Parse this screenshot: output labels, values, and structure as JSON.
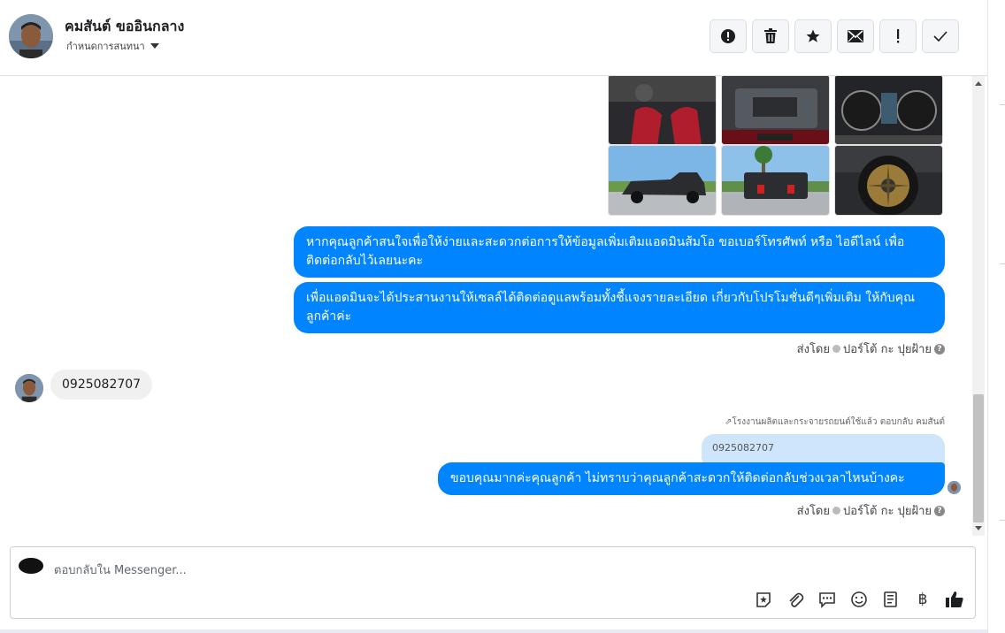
{
  "header": {
    "name": "คมสันต์ ขออินกลาง",
    "subtitle": "กำหนดการสนทนา"
  },
  "icons": {
    "actions": [
      "alert-circle-icon",
      "trash-icon",
      "star-icon",
      "envelope-icon",
      "exclamation-icon",
      "check-icon"
    ]
  },
  "messages": {
    "outgoing_1": "หากคุณลูกค้าสนใจเพื่อให้ง่ายและสะดวกต่อการให้ข้อมูลเพิ่มเติมแอดมินส้มโอ ขอเบอร์โทรศัพท์ หรือ ไอดีไลน์ เพื่อติดต่อกลับไว้เลยนะคะ",
    "outgoing_2": "เพื่อแอดมินจะได้ประสานงานให้เซลล์ได้ติดต่อดูแลพร้อมทั้งชี้แจงรายละเอียด เกี่ยวกับโปรโมชั่นดีๆเพิ่มเติม ให้กับคุณลูกค้าค่ะ",
    "sent_by_1": "ส่งโดย",
    "sent_by_name_1": "ปอร์โต้ กะ ปุยฝ้าย",
    "incoming": "0925082707",
    "reply_note": "โรงงานผลิตและกระจายรถยนต์ใช้แล้ว ตอบกลับ คมสันต์",
    "quoted": "0925082707",
    "outgoing_3": "ขอบคุณมากค่ะคุณลูกค้า ไม่ทราบว่าคุณลูกค้าสะดวกให้ติดต่อกลับช่วงเวลาไหนบ้างคะ",
    "sent_by_2": "ส่งโดย",
    "sent_by_name_2": "ปอร์โต้ กะ ปุยฝ้าย"
  },
  "composer": {
    "placeholder": "ตอบกลับใน Messenger...",
    "currency_symbol": "฿"
  },
  "colors": {
    "accent": "#0084ff",
    "incoming_bubble": "#f0f0f0",
    "quoted_bubble": "#cfe5fb"
  }
}
